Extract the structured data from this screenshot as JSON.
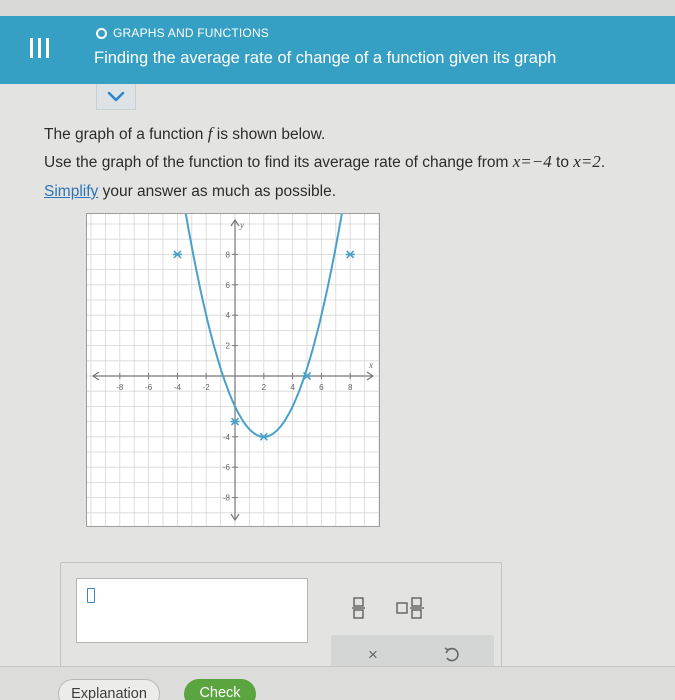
{
  "header": {
    "section": "GRAPHS AND FUNCTIONS",
    "title": "Finding the average rate of change of a function given its graph",
    "menu_icon": "hamburger-menu-icon",
    "status_icon": "circle-status-icon",
    "color": "#36a0c4"
  },
  "expand_icon": "chevron-down-icon",
  "question": {
    "line1_a": "The graph of a function ",
    "fn": "f",
    "line1_b": " is shown below.",
    "line2_a": "Use the graph of the function to find its average rate of change from ",
    "expr1": "x=−4",
    "line2_b": " to ",
    "expr2": "x=2",
    "line2_c": "."
  },
  "simplify": {
    "link": "Simplify",
    "rest": " your answer as much as possible."
  },
  "chart_data": {
    "type": "line",
    "xlim": [
      -10,
      10
    ],
    "ylim": [
      -10,
      10
    ],
    "grid": true,
    "x_ticks": [
      "-8",
      "-6",
      "-4",
      "-2",
      "2",
      "4",
      "6",
      "8"
    ],
    "y_ticks": [
      "8",
      "6",
      "4",
      "2",
      "-4",
      "-6",
      "-8"
    ],
    "x_axis_label": "x",
    "y_axis_label": "y",
    "curve_points": [
      [
        -4,
        8
      ],
      [
        -1.5,
        0
      ],
      [
        0,
        -3
      ],
      [
        2,
        -4
      ],
      [
        4,
        -3
      ],
      [
        5,
        0
      ],
      [
        8,
        8
      ]
    ],
    "marked_points": [
      [
        -4,
        8
      ],
      [
        0,
        -3
      ],
      [
        2,
        -4
      ],
      [
        5,
        0
      ],
      [
        8,
        8
      ]
    ],
    "curve_color": "#4aa0c8"
  },
  "answer": {
    "value": ""
  },
  "tools": {
    "fraction": "fraction-icon",
    "mixed_number": "mixed-number-icon",
    "clear": "×",
    "undo": "undo-icon"
  },
  "footer": {
    "explanation": "Explanation",
    "check": "Check",
    "check_color": "#5aa53f"
  }
}
